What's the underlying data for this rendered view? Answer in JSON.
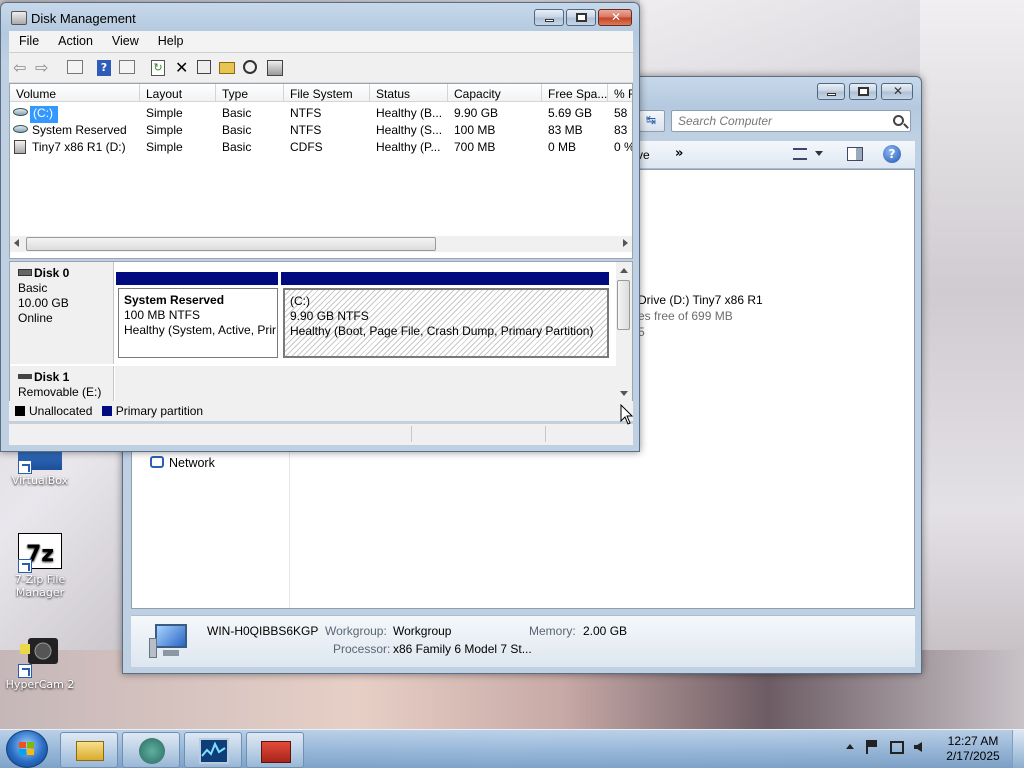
{
  "desktop": {
    "icons": [
      {
        "label": "VirtualBox"
      },
      {
        "label": "7-Zip File Manager"
      },
      {
        "label": "HyperCam 2"
      }
    ]
  },
  "explorer": {
    "search_placeholder": "Search Computer",
    "toolbar_partial_left": "ve",
    "toolbar_more": "»",
    "drive_line1": "Drive (D:) Tiny7 x86 R1",
    "drive_line2": "es free of 699 MB",
    "drive_line3": "5",
    "nav_network": "Network",
    "computer_name": "WIN-H0QIBBS6KGP",
    "workgroup_label": "Workgroup:",
    "workgroup_value": "Workgroup",
    "memory_label": "Memory:",
    "memory_value": "2.00 GB",
    "processor_label": "Processor:",
    "processor_value": "x86 Family 6 Model 7 St..."
  },
  "diskmgmt": {
    "title": "Disk Management",
    "menu": [
      "File",
      "Action",
      "View",
      "Help"
    ],
    "columns": [
      "Volume",
      "Layout",
      "Type",
      "File System",
      "Status",
      "Capacity",
      "Free Spa...",
      "% F"
    ],
    "rows": [
      [
        "(C:)",
        "Simple",
        "Basic",
        "NTFS",
        "Healthy (B...",
        "9.90 GB",
        "5.69 GB",
        "58"
      ],
      [
        "System Reserved",
        "Simple",
        "Basic",
        "NTFS",
        "Healthy (S...",
        "100 MB",
        "83 MB",
        "83"
      ],
      [
        "Tiny7 x86 R1 (D:)",
        "Simple",
        "Basic",
        "CDFS",
        "Healthy (P...",
        "700 MB",
        "0 MB",
        "0 %"
      ]
    ],
    "disk0": {
      "name": "Disk 0",
      "type": "Basic",
      "size": "10.00 GB",
      "state": "Online",
      "partitions": [
        {
          "name": "System Reserved",
          "size": "100 MB NTFS",
          "status": "Healthy (System, Active, Prir"
        },
        {
          "name": "(C:)",
          "size": "9.90 GB NTFS",
          "status": "Healthy (Boot, Page File, Crash Dump, Primary Partition)"
        }
      ]
    },
    "disk1": {
      "name": "Disk 1",
      "type": "Removable (E:)"
    },
    "legend": {
      "unallocated": "Unallocated",
      "primary": "Primary partition",
      "unallocated_color": "#000000",
      "primary_color": "#000b80"
    }
  },
  "taskbar": {
    "time": "12:27 AM",
    "date": "2/17/2025"
  }
}
